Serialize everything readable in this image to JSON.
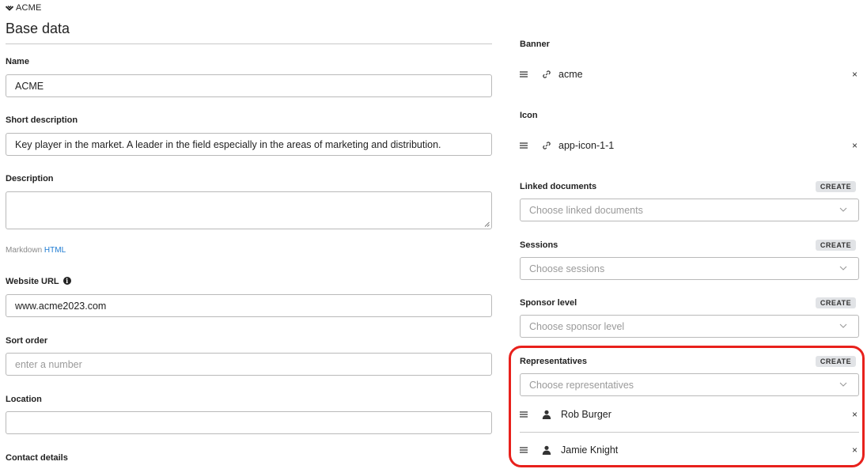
{
  "breadcrumb": {
    "label": "ACME",
    "icon": "chevron-down-icon"
  },
  "base": {
    "title": "Base data",
    "name": {
      "label": "Name",
      "value": "ACME"
    },
    "short_description": {
      "label": "Short description",
      "value": "Key player in the market. A leader in the field especially in the areas of marketing and distribution."
    },
    "description": {
      "label": "Description",
      "value": "",
      "format_hint": "Markdown",
      "format_link": "HTML"
    },
    "website": {
      "label": "Website URL",
      "value": "www.acme2023.com",
      "info_icon": "info-icon"
    },
    "sort_order": {
      "label": "Sort order",
      "placeholder": "enter a number"
    },
    "location": {
      "label": "Location",
      "value": ""
    },
    "contact": {
      "label": "Contact details"
    }
  },
  "media": {
    "banner": {
      "label": "Banner",
      "value": "acme",
      "icon": "link-icon"
    },
    "icon": {
      "label": "Icon",
      "value": "app-icon-1-1",
      "icon": "link-icon"
    }
  },
  "relations": {
    "create_label": "CREATE",
    "linked_documents": {
      "label": "Linked documents",
      "placeholder": "Choose linked documents"
    },
    "sessions": {
      "label": "Sessions",
      "placeholder": "Choose sessions"
    },
    "sponsor_level": {
      "label": "Sponsor level",
      "placeholder": "Choose sponsor level"
    },
    "representatives": {
      "label": "Representatives",
      "placeholder": "Choose representatives",
      "items": [
        {
          "name": "Rob Burger",
          "icon": "person-icon"
        },
        {
          "name": "Jamie Knight",
          "icon": "person-icon"
        }
      ]
    }
  },
  "remove_symbol": "×",
  "colors": {
    "highlight": "#e8211c",
    "link": "#1e7bd2",
    "button_bg": "#e1e3e6"
  }
}
